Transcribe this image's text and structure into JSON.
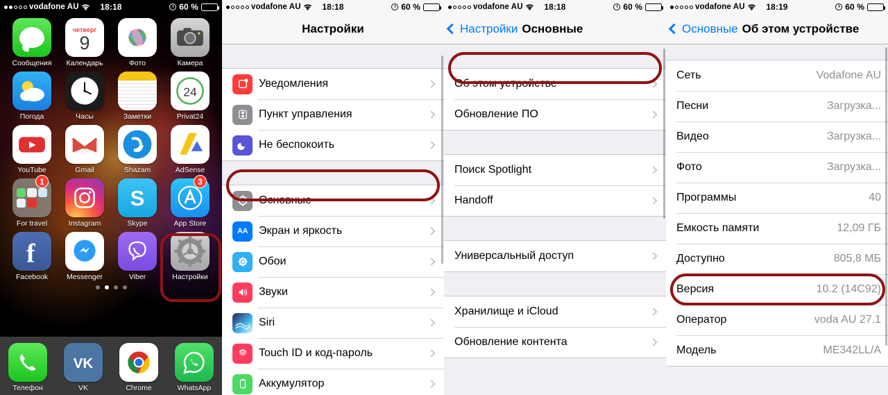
{
  "panels": [
    {
      "name": "home-screen",
      "statusbar": {
        "signal_dots_filled": 2,
        "signal_dots_total": 5,
        "carrier": "vodafone AU",
        "time": "18:18",
        "battery_percent": "60 %",
        "battery_level": 60,
        "alarm_icon": "alarm-icon",
        "wifi_icon": "wifi-icon"
      },
      "apps": [
        {
          "label": "Сообщения",
          "icon": "messages-icon",
          "badge": null
        },
        {
          "label": "Календарь",
          "icon": "calendar-icon",
          "badge": null,
          "weekday": "четверг",
          "day": "9"
        },
        {
          "label": "Фото",
          "icon": "photos-icon",
          "badge": null
        },
        {
          "label": "Камера",
          "icon": "camera-icon",
          "badge": null
        },
        {
          "label": "Погода",
          "icon": "weather-icon",
          "badge": null
        },
        {
          "label": "Часы",
          "icon": "clock-icon",
          "badge": null
        },
        {
          "label": "Заметки",
          "icon": "notes-icon",
          "badge": null
        },
        {
          "label": "Privat24",
          "icon": "privat24-icon",
          "badge": null,
          "day": "24"
        },
        {
          "label": "YouTube",
          "icon": "youtube-icon",
          "badge": null
        },
        {
          "label": "Gmail",
          "icon": "gmail-icon",
          "badge": null
        },
        {
          "label": "Shazam",
          "icon": "shazam-icon",
          "badge": null
        },
        {
          "label": "AdSense",
          "icon": "adsense-icon",
          "badge": null
        },
        {
          "label": "For travel",
          "icon": "folder-icon",
          "badge": "1"
        },
        {
          "label": "Instagram",
          "icon": "instagram-icon",
          "badge": null
        },
        {
          "label": "Skype",
          "icon": "skype-icon",
          "badge": null
        },
        {
          "label": "App Store",
          "icon": "appstore-icon",
          "badge": "3"
        },
        {
          "label": "Facebook",
          "icon": "facebook-icon",
          "badge": null
        },
        {
          "label": "Messenger",
          "icon": "messenger-icon",
          "badge": null
        },
        {
          "label": "Viber",
          "icon": "viber-icon",
          "badge": null
        },
        {
          "label": "Настройки",
          "icon": "settings-icon",
          "badge": null,
          "highlighted": true
        }
      ],
      "page_dots": {
        "count": 4,
        "active_index": 1
      },
      "dock": [
        {
          "label": "Телефон",
          "icon": "phone-icon"
        },
        {
          "label": "VK",
          "icon": "vk-icon"
        },
        {
          "label": "Chrome",
          "icon": "chrome-icon"
        },
        {
          "label": "WhatsApp",
          "icon": "whatsapp-icon"
        }
      ]
    },
    {
      "name": "settings-root",
      "statusbar": {
        "signal_dots_filled": 1,
        "signal_dots_total": 5,
        "carrier": "vodafone AU",
        "time": "18:18",
        "battery_percent": "60 %",
        "battery_level": 60
      },
      "nav": {
        "title": "Настройки"
      },
      "groups": [
        {
          "rows": [
            {
              "label": "Уведомления",
              "icon": "notifications-icon",
              "icon_class": "sicon-notif"
            },
            {
              "label": "Пункт управления",
              "icon": "control-center-icon",
              "icon_class": "sicon-cc"
            },
            {
              "label": "Не беспокоить",
              "icon": "do-not-disturb-icon",
              "icon_class": "sicon-dnd"
            }
          ]
        },
        {
          "rows": [
            {
              "label": "Основные",
              "icon": "general-icon",
              "icon_class": "sicon-gen",
              "highlighted": true
            },
            {
              "label": "Экран и яркость",
              "icon": "display-brightness-icon",
              "icon_class": "sicon-disp",
              "glyph": "AA"
            },
            {
              "label": "Обои",
              "icon": "wallpaper-icon",
              "icon_class": "sicon-wall"
            },
            {
              "label": "Звуки",
              "icon": "sounds-icon",
              "icon_class": "sicon-snd"
            },
            {
              "label": "Siri",
              "icon": "siri-icon",
              "icon_class": "sicon-siri"
            },
            {
              "label": "Touch ID и код-пароль",
              "icon": "touch-id-icon",
              "icon_class": "sicon-touch"
            },
            {
              "label": "Аккумулятор",
              "icon": "battery-icon",
              "icon_class": "sicon-batt"
            }
          ]
        }
      ]
    },
    {
      "name": "settings-general",
      "statusbar": {
        "signal_dots_filled": 1,
        "signal_dots_total": 5,
        "carrier": "vodafone AU",
        "time": "18:18",
        "battery_percent": "60 %",
        "battery_level": 60
      },
      "nav": {
        "back_label": "Настройки",
        "title": "Основные"
      },
      "groups": [
        {
          "rows": [
            {
              "label": "Об этом устройстве",
              "highlighted": true
            },
            {
              "label": "Обновление ПО"
            }
          ]
        },
        {
          "rows": [
            {
              "label": "Поиск Spotlight"
            },
            {
              "label": "Handoff"
            }
          ]
        },
        {
          "rows": [
            {
              "label": "Универсальный доступ"
            }
          ]
        },
        {
          "rows": [
            {
              "label": "Хранилище и iCloud"
            },
            {
              "label": "Обновление контента"
            }
          ]
        }
      ]
    },
    {
      "name": "settings-about",
      "statusbar": {
        "signal_dots_filled": 1,
        "signal_dots_total": 5,
        "carrier": "vodafone AU",
        "time": "18:19",
        "battery_percent": "60 %",
        "battery_level": 60
      },
      "nav": {
        "back_label": "Основные",
        "title": "Об этом устройстве"
      },
      "groups": [
        {
          "rows": [
            {
              "label": "Сеть",
              "value": "Vodafone AU"
            },
            {
              "label": "Песни",
              "value": "Загрузка..."
            },
            {
              "label": "Видео",
              "value": "Загрузка..."
            },
            {
              "label": "Фото",
              "value": "Загрузка..."
            },
            {
              "label": "Программы",
              "value": "40"
            },
            {
              "label": "Емкость памяти",
              "value": "12,09 ГБ"
            },
            {
              "label": "Доступно",
              "value": "805,8 МБ"
            },
            {
              "label": "Версия",
              "value": "10.2 (14C92)",
              "highlighted": true
            },
            {
              "label": "Оператор",
              "value": "voda AU 27.1"
            },
            {
              "label": "Модель",
              "value": "ME342LL/A"
            }
          ]
        }
      ]
    }
  ],
  "annotation": {
    "color": "#8f1414",
    "shape": "ellipse-outline"
  }
}
